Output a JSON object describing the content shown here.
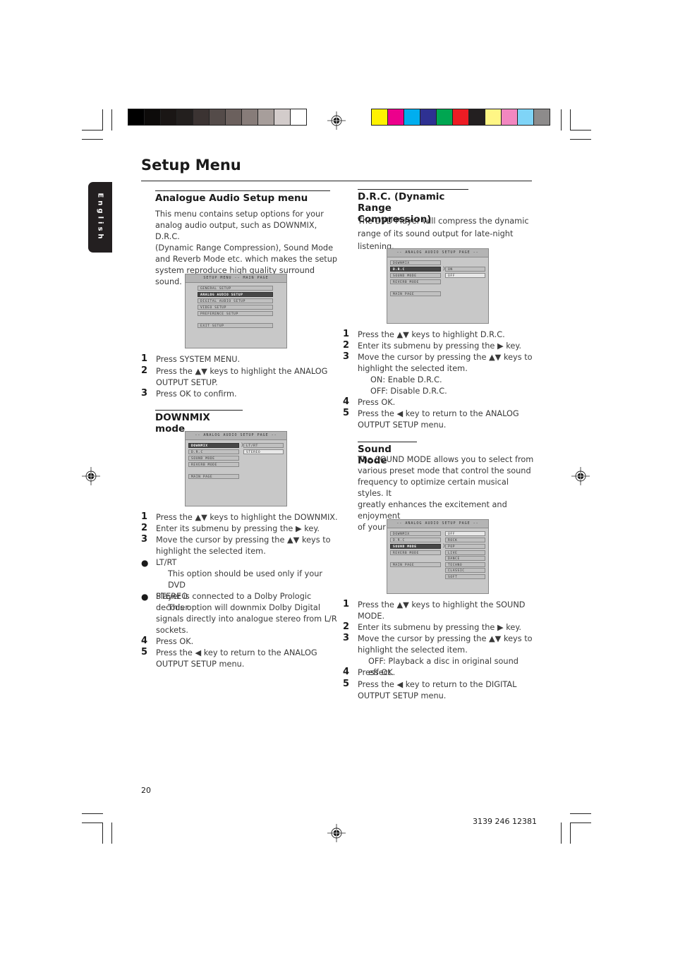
{
  "print_marks": {
    "gray_bar": [
      "#000000",
      "#0d0b0a",
      "#1a1615",
      "#231f1e",
      "#3b3332",
      "#544b49",
      "#6b605d",
      "#877c79",
      "#a79e9b",
      "#d3cccb",
      "#ffffff"
    ],
    "color_bar": [
      "#fff200",
      "#ec008c",
      "#00aeef",
      "#2e3192",
      "#00a651",
      "#ed1c24",
      "#231f20",
      "#fff685",
      "#f287c0",
      "#7fd4f7",
      "#8d8b8b"
    ]
  },
  "sidebar": {
    "language_tab": "English"
  },
  "header": {
    "title": "Setup Menu"
  },
  "left": {
    "analogue": {
      "heading": "Analogue Audio Setup menu",
      "intro": [
        "This menu contains setup options for your",
        "analog audio output, such as DOWNMIX, D.R.C.",
        "(Dynamic Range Compression), Sound Mode",
        "and Reverb Mode etc. which makes the setup",
        "system reproduce high quality surround sound."
      ],
      "osd": {
        "title": "SETUP MENU -- MAIN PAGE",
        "items": [
          "GENERAL SETUP",
          "ANALOG AUDIO SETUP",
          "DIGITAL AUDIO SETUP",
          "VIDEO SETUP",
          "PREFERENCE SETUP"
        ],
        "selected": "ANALOG AUDIO SETUP",
        "exit": "EXIT SETUP"
      },
      "steps": [
        {
          "num": "1",
          "lines": [
            "Press SYSTEM MENU."
          ]
        },
        {
          "num": "2",
          "lines": [
            "Press the ▲▼ keys to highlight the ANALOG",
            "OUTPUT SETUP."
          ]
        },
        {
          "num": "3",
          "lines": [
            "Press OK to confirm."
          ]
        }
      ]
    },
    "downmix": {
      "heading": "DOWNMIX mode",
      "osd": {
        "title": "-- ANALOG AUDIO SETUP PAGE --",
        "items": [
          "DOWNMIX",
          "D.R.C",
          "SOUND MODE",
          "REVERB MODE"
        ],
        "selected": "DOWNMIX",
        "main_page": "MAIN PAGE",
        "options": [
          "LT/RT",
          "STEREO"
        ],
        "current_option": "STEREO"
      },
      "steps": [
        {
          "num": "1",
          "text": "Press the ▲▼ keys to highlight the DOWNMIX."
        },
        {
          "num": "2",
          "text": "Enter its submenu by pressing the ▶  key."
        },
        {
          "num": "3",
          "text": "Move the cursor by pressing the ▲▼ keys to",
          "text2": "highlight the selected item."
        },
        {
          "bullet": "●",
          "text": "LT/RT"
        },
        {
          "text": "This option should be used only if your DVD",
          "text2": "Player is connected to a Dolby Prologic decoder."
        },
        {
          "bullet": "●",
          "text": "STEREO"
        },
        {
          "text": "This option will downmix Dolby Digital",
          "text2": "signals directly into analogue stereo from L/R",
          "text3": "sockets."
        },
        {
          "num": "4",
          "text": "Press OK."
        },
        {
          "num": "5",
          "text": "Press the ◀ key to return to the ANALOG",
          "text2": "OUTPUT SETUP menu."
        }
      ]
    }
  },
  "right": {
    "drc": {
      "heading_line1": "D.R.C. (Dynamic Range",
      "heading_line2": "Compression)",
      "intro": [
        "The DVD Player will compress the dynamic",
        "range of its sound output for late-night listening."
      ],
      "osd": {
        "title": "-- ANALOG AUDIO SETUP PAGE --",
        "items": [
          "DOWNMIX",
          "D.R.C",
          "SOUND MODE",
          "REVERB MODE"
        ],
        "selected": "D.R.C",
        "main_page": "MAIN PAGE",
        "options": [
          "ON",
          "OFF"
        ],
        "current_option": "OFF"
      },
      "steps": [
        {
          "num": "1",
          "text": "Press the ▲▼ keys to highlight D.R.C."
        },
        {
          "num": "2",
          "text": "Enter its submenu by pressing the ▶  key."
        },
        {
          "num": "3",
          "text": "Move the cursor by pressing the ▲▼ keys to",
          "text2": "highlight the selected item."
        },
        {
          "text": "ON: Enable D.R.C."
        },
        {
          "text": "OFF: Disable D.R.C."
        },
        {
          "num": "4",
          "text": "Press OK."
        },
        {
          "num": "5",
          "text": "Press the ◀ key to return to the ANALOG",
          "text2": "OUTPUT SETUP menu."
        }
      ]
    },
    "sound": {
      "heading": "Sound Mode",
      "intro": [
        "The SOUND MODE allows you to select from",
        "various preset mode that control the sound",
        "frequency to optimize certain musical styles. It",
        "greatly enhances the excitement and enjoyment",
        "of your favourite music."
      ],
      "osd": {
        "title": "-- ANALOG AUDIO SETUP PAGE --",
        "items": [
          "DOWNMIX",
          "D.R.C",
          "SOUND MODE",
          "REVERB MODE"
        ],
        "selected": "SOUND MODE",
        "main_page": "MAIN PAGE",
        "options": [
          "OFF",
          "ROCK",
          "POP",
          "LIVE",
          "DANCE",
          "TECHNO",
          "CLASSIC",
          "SOFT"
        ],
        "current_option": "OFF"
      },
      "steps": [
        {
          "num": "1",
          "text": "Press the ▲▼ keys to highlight the SOUND",
          "text2": "MODE."
        },
        {
          "num": "2",
          "text": "Enter its submenu by pressing the ▶  key."
        },
        {
          "num": "3",
          "text": "Move the cursor by pressing the ▲▼ keys to",
          "text2": "highlight the selected item."
        },
        {
          "text": "OFF: Playback a disc in original sound effect."
        },
        {
          "num": "4",
          "text": "Press OK."
        },
        {
          "num": "5",
          "text": "Press the ◀ key to return to the DIGITAL",
          "text2": "OUTPUT SETUP menu."
        }
      ]
    }
  },
  "footer": {
    "page_number": "20",
    "doc_code": "3139 246 12381"
  }
}
